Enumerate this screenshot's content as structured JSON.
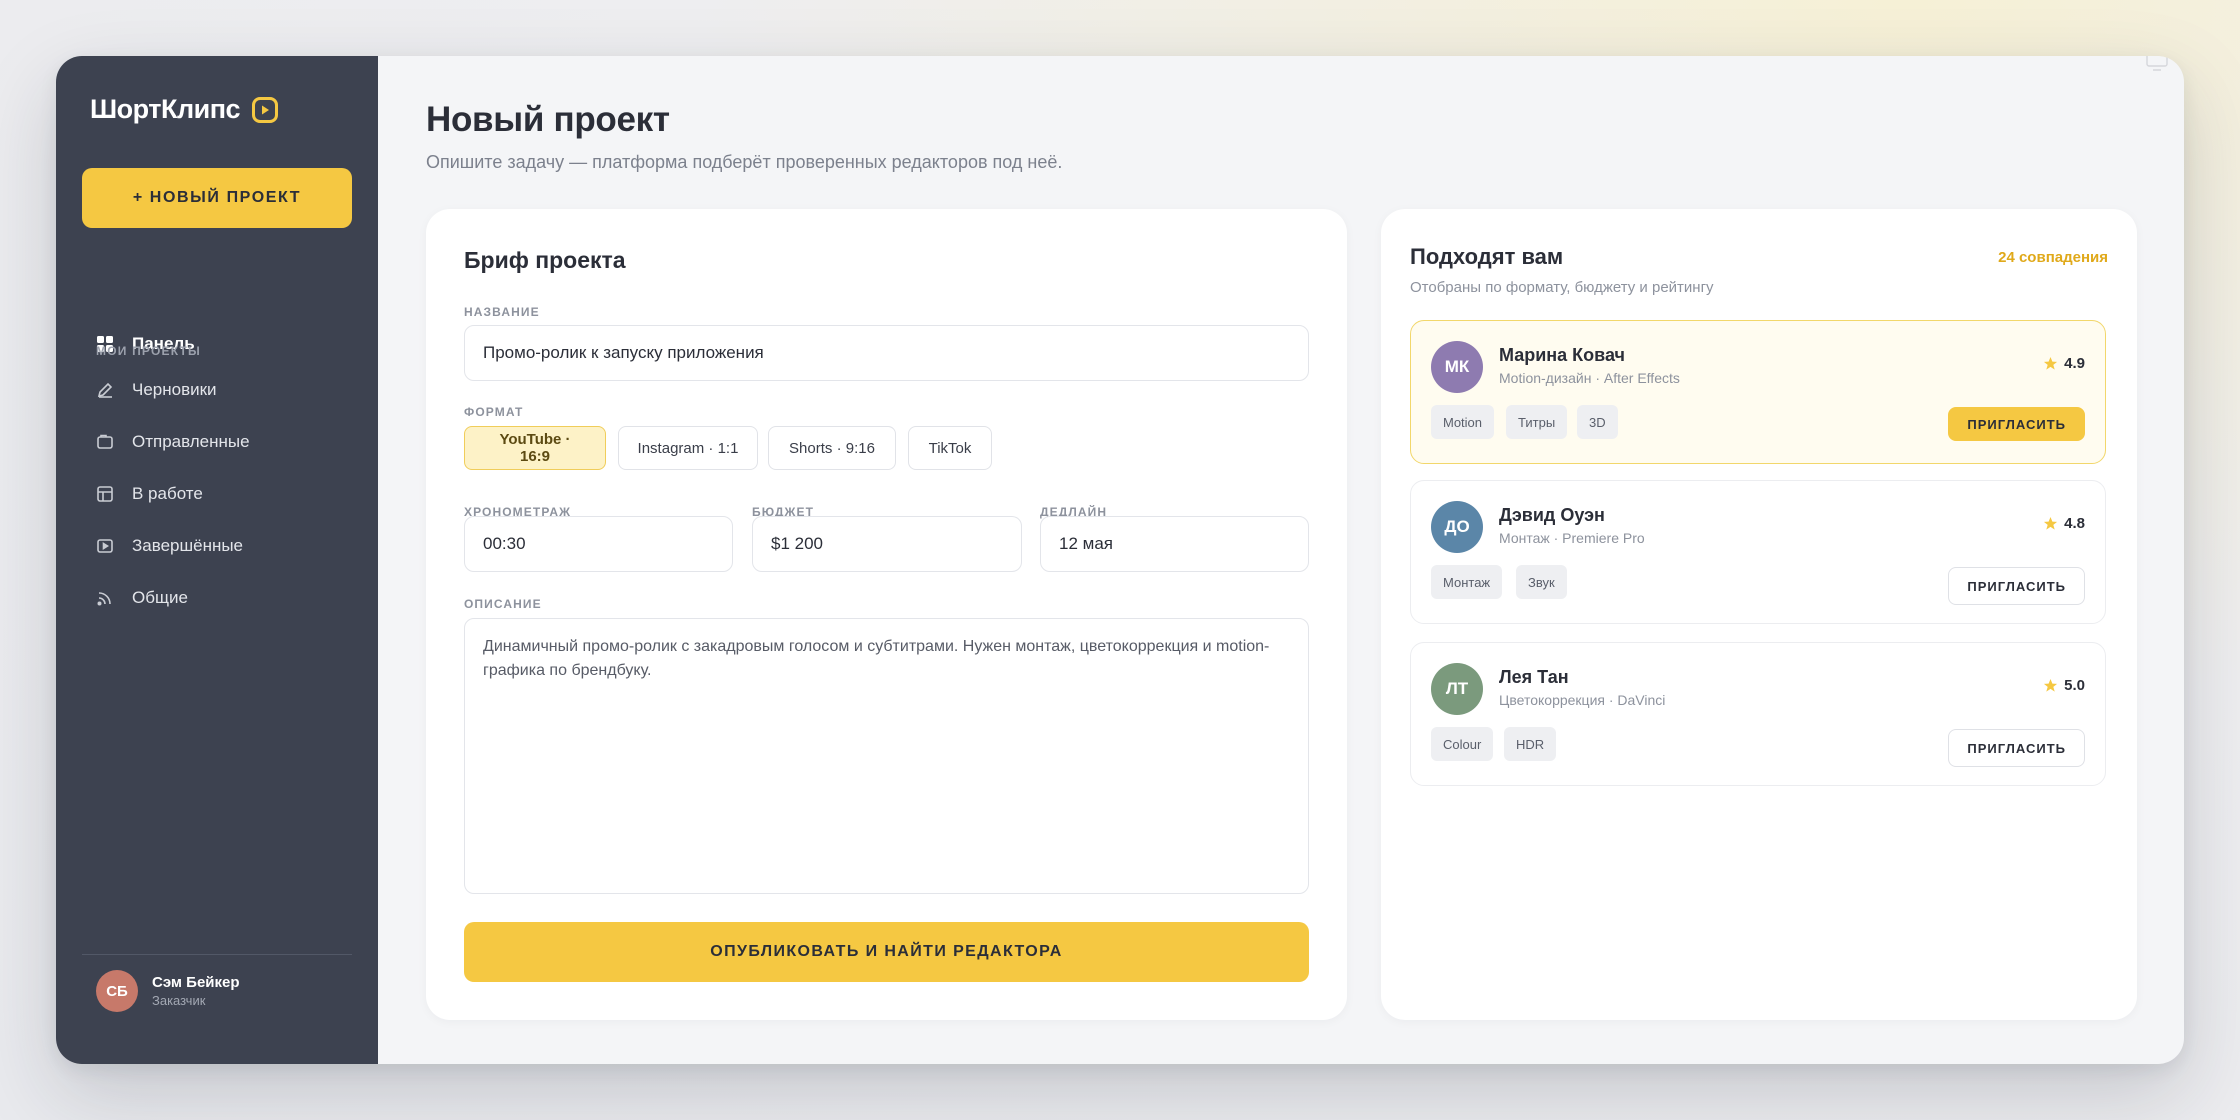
{
  "sidebar": {
    "brand": "ШортКлипс",
    "new_project": "+  НОВЫЙ ПРОЕКТ",
    "nav_primary": "Панель",
    "section_label": "МОИ ПРОЕКТЫ",
    "items": [
      {
        "label": "Черновики",
        "icon": "pencil-icon"
      },
      {
        "label": "Отправленные",
        "icon": "folder-icon"
      },
      {
        "label": "В работе",
        "icon": "layout-icon"
      },
      {
        "label": "Завершённые",
        "icon": "play-square-icon"
      },
      {
        "label": "Общие",
        "icon": "rss-icon"
      }
    ],
    "user": {
      "initials": "СБ",
      "name": "Сэм Бейкер",
      "role": "Заказчик"
    }
  },
  "header": {
    "title": "Новый проект",
    "subtitle": "Опишите задачу — платформа подберёт проверенных редакторов под неё."
  },
  "brief": {
    "title": "Бриф проекта",
    "name_label": "НАЗВАНИЕ",
    "name_value": "Промо-ролик к запуску приложения",
    "format_label": "ФОРМАТ",
    "formats": [
      "YouTube · 16:9",
      "Instagram · 1:1",
      "Shorts · 9:16",
      "TikTok"
    ],
    "selected_format": "YouTube · 16:9",
    "duration_label": "ХРОНОМЕТРАЖ",
    "duration_value": "00:30",
    "budget_label": "БЮДЖЕТ",
    "budget_value": "$1 200",
    "deadline_label": "ДЕДЛАЙН",
    "deadline_value": "12 мая",
    "description_label": "ОПИСАНИЕ",
    "description_value": "Динамичный промо-ролик с закадровым голосом и субтитрами. Нужен монтаж, цветокоррекция и motion-графика по брендбуку.",
    "publish": "ОПУБЛИКОВАТЬ И НАЙТИ РЕДАКТОРА"
  },
  "matches": {
    "title": "Подходят вам",
    "count": "24 совпадения",
    "subtitle": "Отобраны по формату, бюджету и рейтингу",
    "invite_label": "ПРИГЛАСИТЬ",
    "editors": [
      {
        "initials": "МК",
        "name": "Марина Ковач",
        "role": "Motion-дизайн · After Effects",
        "rating": "4.9",
        "tags": [
          "Motion",
          "Титры",
          "3D"
        ],
        "avatar_color": "#8e7bb0"
      },
      {
        "initials": "ДО",
        "name": "Дэвид Оуэн",
        "role": "Монтаж · Premiere Pro",
        "rating": "4.8",
        "tags": [
          "Монтаж",
          "Звук"
        ],
        "avatar_color": "#5b86a8"
      },
      {
        "initials": "ЛТ",
        "name": "Лея Тан",
        "role": "Цветокоррекция · DaVinci",
        "rating": "5.0",
        "tags": [
          "Colour",
          "HDR"
        ],
        "avatar_color": "#7b9a7d"
      }
    ]
  },
  "colors": {
    "accent": "#f5c842",
    "sidebar": "#3d4250",
    "count": "#e0a91a"
  }
}
